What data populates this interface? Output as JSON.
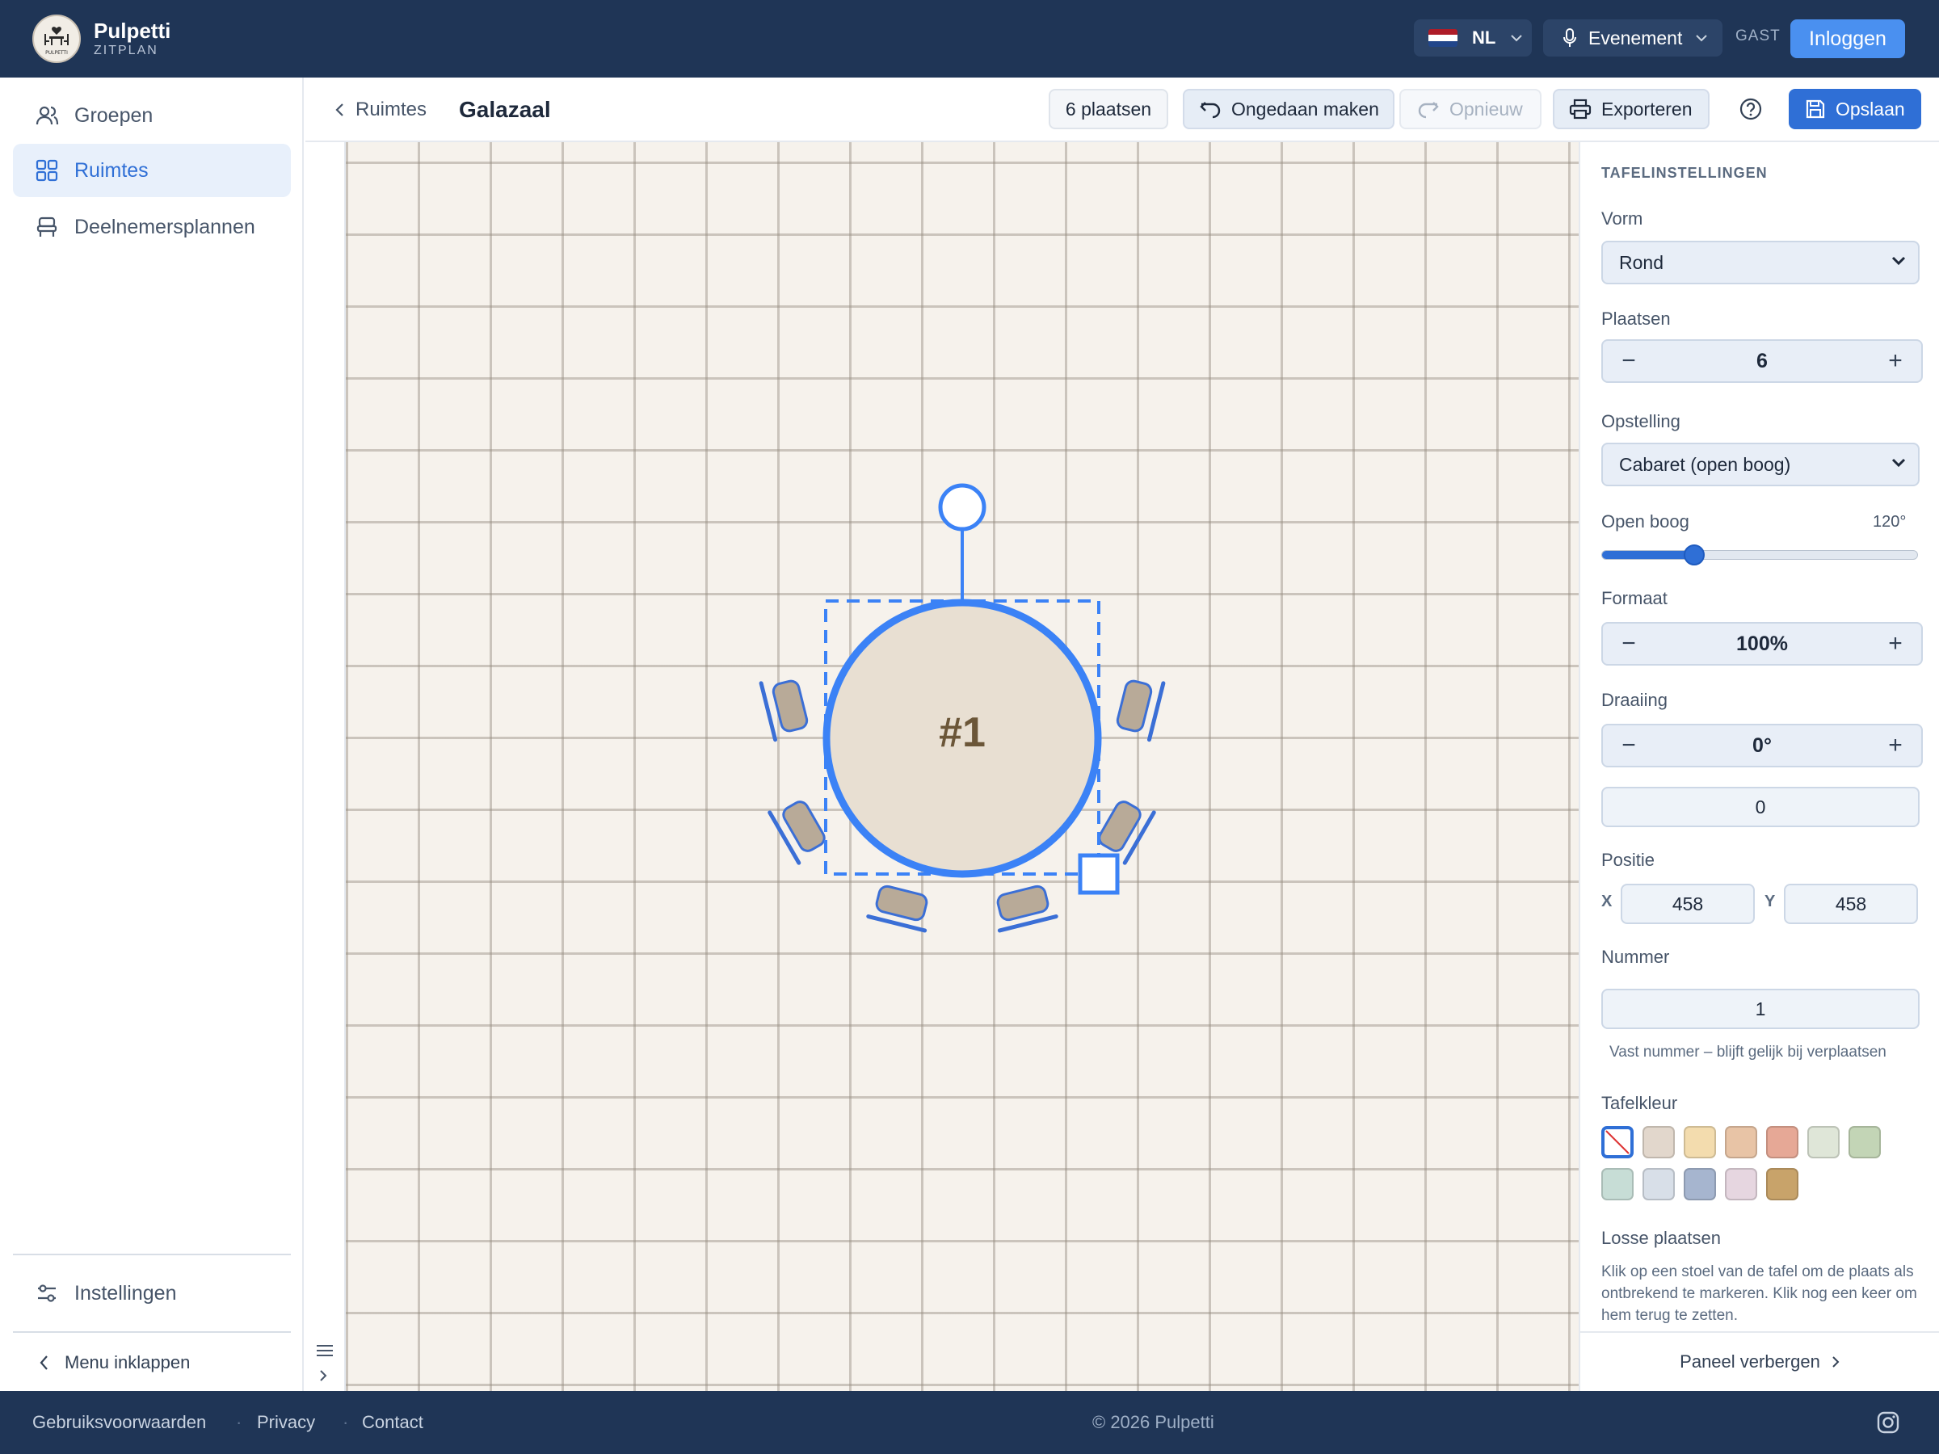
{
  "app": {
    "name": "Pulpetti",
    "subtitle": "ZITPLAN",
    "logo_text": "PULPETTI"
  },
  "topbar": {
    "language": "NL",
    "event_label": "Evenement",
    "role": "GAST",
    "login_label": "Inloggen"
  },
  "sidebar": {
    "items": [
      {
        "label": "Groepen",
        "icon": "users-icon",
        "active": false
      },
      {
        "label": "Ruimtes",
        "icon": "grid-icon",
        "active": true
      },
      {
        "label": "Deelnemersplannen",
        "icon": "chair-icon",
        "active": false
      }
    ],
    "settings_label": "Instellingen",
    "collapse_label": "Menu inklappen"
  },
  "header": {
    "back_label": "Ruimtes",
    "title": "Galazaal",
    "seats_badge": "6 plaatsen",
    "undo_label": "Ongedaan maken",
    "redo_label": "Opnieuw",
    "export_label": "Exporteren",
    "save_label": "Opslaan"
  },
  "canvas": {
    "table_label": "#1",
    "table_color": "#e8dfd2",
    "selection_color": "#3b82f6",
    "chair_color": "#b8aa98"
  },
  "panel": {
    "section_title": "TAFELINSTELLINGEN",
    "shape_label": "Vorm",
    "shape_value": "Rond",
    "seats_label": "Plaatsen",
    "seats_value": "6",
    "layout_label": "Opstelling",
    "layout_value": "Cabaret (open boog)",
    "arc_label": "Open boog",
    "arc_value": "120°",
    "arc_fraction": 0.29,
    "size_label": "Formaat",
    "size_value": "100%",
    "rotation_label": "Draaiing",
    "rotation_value": "0°",
    "rotation_input": "0",
    "position_label": "Positie",
    "pos_x_label": "X",
    "pos_x_value": "458",
    "pos_y_label": "Y",
    "pos_y_value": "458",
    "number_label": "Nummer",
    "number_value": "1",
    "number_hint": "Vast nummer – blijft gelijk bij verplaatsen",
    "color_label": "Tafelkleur",
    "swatches": [
      "#ffffff",
      "#e2d7cc",
      "#f3dcae",
      "#e8c4a6",
      "#e6a896",
      "#dfe6d8",
      "#c3d5b6",
      "#c7ddd6",
      "#d8dfe8",
      "#a6b5cf",
      "#e6d6e0",
      "#c8a36a"
    ],
    "loose_label": "Losse plaatsen",
    "loose_text": "Klik op een stoel van de tafel om de plaats als ontbrekend te markeren. Klik nog een keer om hem terug te zetten.",
    "hide_label": "Paneel verbergen"
  },
  "footer": {
    "terms": "Gebruiksvoorwaarden",
    "privacy": "Privacy",
    "contact": "Contact",
    "separator": "·",
    "copyright": "© 2026 Pulpetti"
  }
}
